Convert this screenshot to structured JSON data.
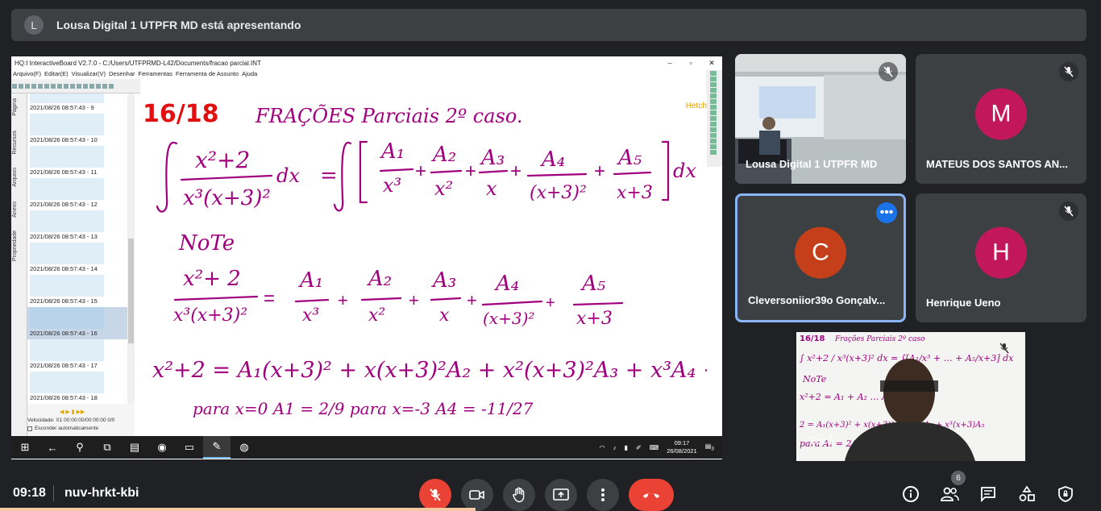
{
  "banner": {
    "initial": "L",
    "text": "Lousa Digital 1 UTPFR MD está apresentando"
  },
  "app": {
    "title": "HQ:I InteractiveBoard V2.7.0 - C:/Users/UTFPRMD-L42/Documents/fracao parcial.INT",
    "menu": [
      "Arquivo(F)",
      "Editar(E)",
      "Visualizar(V)",
      "Desenhar",
      "Ferramentas",
      "Ferramenta de Assunto",
      "Ajuda"
    ],
    "side_tabs": [
      "Página",
      "Recursos",
      "Arquivo",
      "Anexo",
      "Propriedade"
    ],
    "thumbnails": [
      "2021/08/26 08:57:43 - 9",
      "2021/08/26 08:57:43 - 10",
      "2021/08/26 08:57:43 - 11",
      "2021/08/26 08:57:43 - 12",
      "2021/08/26 08:57:43 - 13",
      "2021/08/26 08:57:43 - 14",
      "2021/08/26 08:57:43 - 15",
      "2021/08/26 08:57:43 - 16",
      "2021/08/26 08:57:43 - 17",
      "2021/08/26 08:57:43 - 18"
    ],
    "selected_thumbnail": "2021/08/26 08:57:43 - 16",
    "speed": "Velocidade: X1 00:00:00/00:00:00 0/0",
    "autohide": "Esconder automaticamente",
    "page_number": "16/18",
    "brand": "HetchT",
    "handwriting_title": "FRAÇÕES Parciais 2º caso.",
    "note": "NoTe",
    "condition": "para x=0  A1 = 2/9   para x=-3   A4 = -11/27"
  },
  "taskbar": {
    "time": "09:17",
    "date": "26/08/2021",
    "notifications": "3"
  },
  "tiles": [
    {
      "name": "Lousa Digital 1 UTPFR MD",
      "muted": true
    },
    {
      "name": "MATEUS DOS SANTOS AN...",
      "initial": "M",
      "color": "#c2185b",
      "muted": true
    },
    {
      "name": "Cleversoniior39o Gonçalv...",
      "initial": "C",
      "color": "#c5401a",
      "muted": false
    },
    {
      "name": "Henrique Ueno",
      "initial": "H",
      "color": "#c2185b",
      "muted": true
    },
    {
      "name": "Você",
      "muted": true
    }
  ],
  "self_tile": {
    "page": "16/18",
    "title": "Frações Parciais 2º caso"
  },
  "bottom": {
    "time": "09:18",
    "meeting_code": "nuv-hrkt-kbi",
    "participants": "6"
  }
}
